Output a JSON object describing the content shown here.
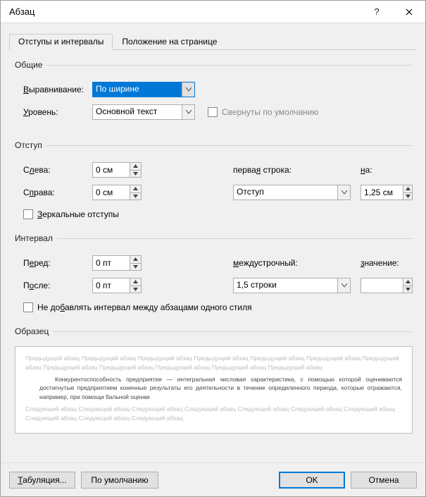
{
  "title": "Абзац",
  "tabs": {
    "indents": "Отступы и интервалы",
    "position": "Положение на странице"
  },
  "general": {
    "legend": "Общие",
    "alignment_label": "Выравнивание:",
    "alignment_value": "По ширине",
    "level_label": "Уровень:",
    "level_value": "Основной текст",
    "collapsed_label": "Свернуты по умолчанию"
  },
  "indent": {
    "legend": "Отступ",
    "left_label": "Слева:",
    "left_value": "0 см",
    "right_label": "Справа:",
    "right_value": "0 см",
    "firstline_label": "первая строка:",
    "firstline_value": "Отступ",
    "by_label": "на:",
    "by_value": "1,25 см",
    "mirror_label": "Зеркальные отступы"
  },
  "spacing": {
    "legend": "Интервал",
    "before_label": "Перед:",
    "before_value": "0 пт",
    "after_label": "После:",
    "after_value": "0 пт",
    "linespacing_label": "междустрочный:",
    "linespacing_value": "1,5 строки",
    "at_label": "значение:",
    "at_value": "",
    "noadd_label": "Не добавлять интервал между абзацами одного стиля"
  },
  "preview": {
    "legend": "Образец",
    "prev_text": "Предыдущий абзац Предыдущий абзац Предыдущий абзац Предыдущий абзац Предыдущий абзац Предыдущий абзац Предыдущий абзац Предыдущий абзац Предыдущий абзац Предыдущий абзац Предыдущий абзац Предыдущий абзац",
    "sample_text": "Конкурентоспособность предприятия — интегральная числовая характеристика, с помощью которой оцениваются достигнутые предприятием конечные результаты его деятельности в течение определенного периода, которые отражаются, например, при помощи бальной оценки",
    "next_text": "Следующий абзац Следующий абзац Следующий абзац Следующий абзац Следующий абзац Следующий абзац Следующий абзац Следующий абзац Следующий абзац Следующий абзац"
  },
  "buttons": {
    "tabs": "Табуляция...",
    "default": "По умолчанию",
    "ok": "OK",
    "cancel": "Отмена"
  }
}
